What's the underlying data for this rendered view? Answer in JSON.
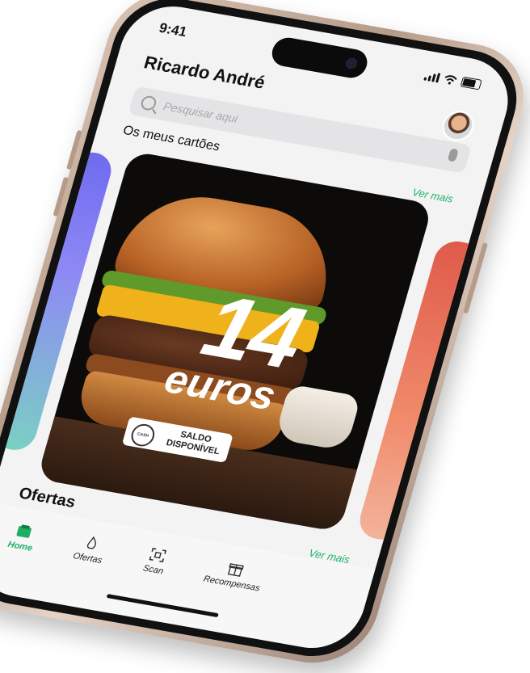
{
  "status_bar": {
    "time": "9:41"
  },
  "header": {
    "user_name": "Ricardo André"
  },
  "search": {
    "placeholder": "Pesquisar aqui"
  },
  "cards_section": {
    "title": "Os meus cartões",
    "see_more": "Ver mais"
  },
  "featured_card": {
    "amount": "14",
    "unit": "euros",
    "badge_icon_text": "CASH BACK",
    "badge_label": "SALDO DISPONÍVEL"
  },
  "offers_section": {
    "title": "Ofertas",
    "see_more": "Ver mais"
  },
  "tabbar": {
    "items": [
      {
        "label": "Home",
        "icon": "home-icon",
        "active": true
      },
      {
        "label": "Ofertas",
        "icon": "flame-icon",
        "active": false
      },
      {
        "label": "Scan",
        "icon": "scan-icon",
        "active": false
      },
      {
        "label": "Recompensas",
        "icon": "gift-icon",
        "active": false
      }
    ]
  },
  "colors": {
    "accent": "#1fae62",
    "card_left_gradient": [
      "#6f6bf0",
      "#7ad0c3"
    ],
    "card_right_gradient": [
      "#e05a4a",
      "#f3b39b"
    ]
  }
}
